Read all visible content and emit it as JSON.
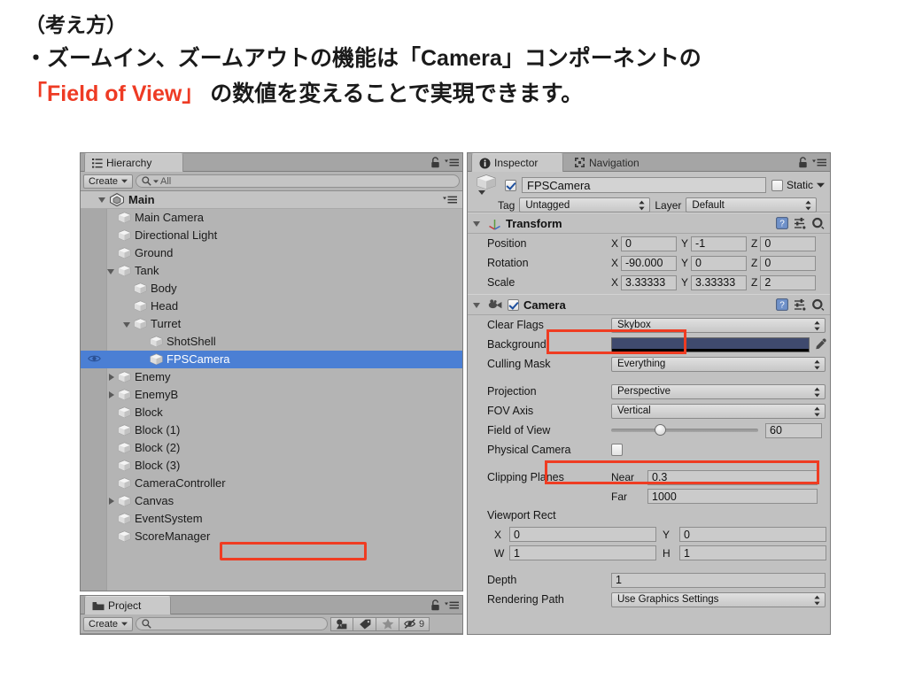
{
  "slide": {
    "line1": "（考え方）",
    "line2_a": "・ズームイン、ズームアウトの機能は「Camera」コンポーネントの",
    "line3_accent": "「Field of View」",
    "line3_rest": " の数値を変えることで実現できます。",
    "accent_color": "#ee3b24"
  },
  "hierarchy": {
    "tab_label": "Hierarchy",
    "tab_icon": "hierarchy-icon",
    "lock_icon": "lock-icon",
    "menu_icon": "hamburger-menu-icon",
    "create_label": "Create",
    "search_placeholder": "All",
    "search_value": "",
    "root": {
      "label": "Main",
      "icon": "unity-scene-icon",
      "expanded": true
    },
    "selected_item": "FPSCamera",
    "items": [
      {
        "label": "Main Camera",
        "indent": 2,
        "arrow": "none",
        "selected": false,
        "eye": false
      },
      {
        "label": "Directional Light",
        "indent": 2,
        "arrow": "none",
        "selected": false,
        "eye": false
      },
      {
        "label": "Ground",
        "indent": 2,
        "arrow": "none",
        "selected": false,
        "eye": false
      },
      {
        "label": "Tank",
        "indent": 2,
        "arrow": "open",
        "selected": false,
        "eye": false
      },
      {
        "label": "Body",
        "indent": 3,
        "arrow": "none",
        "selected": false,
        "eye": false
      },
      {
        "label": "Head",
        "indent": 3,
        "arrow": "none",
        "selected": false,
        "eye": false
      },
      {
        "label": "Turret",
        "indent": 3,
        "arrow": "open",
        "selected": false,
        "eye": false
      },
      {
        "label": "ShotShell",
        "indent": 4,
        "arrow": "none",
        "selected": false,
        "eye": false
      },
      {
        "label": "FPSCamera",
        "indent": 4,
        "arrow": "none",
        "selected": true,
        "eye": true
      },
      {
        "label": "Enemy",
        "indent": 2,
        "arrow": "closed",
        "selected": false,
        "eye": false
      },
      {
        "label": "EnemyB",
        "indent": 2,
        "arrow": "closed",
        "selected": false,
        "eye": false
      },
      {
        "label": "Block",
        "indent": 2,
        "arrow": "none",
        "selected": false,
        "eye": false
      },
      {
        "label": "Block (1)",
        "indent": 2,
        "arrow": "none",
        "selected": false,
        "eye": false
      },
      {
        "label": "Block (2)",
        "indent": 2,
        "arrow": "none",
        "selected": false,
        "eye": false
      },
      {
        "label": "Block (3)",
        "indent": 2,
        "arrow": "none",
        "selected": false,
        "eye": false
      },
      {
        "label": "CameraController",
        "indent": 2,
        "arrow": "none",
        "selected": false,
        "eye": false
      },
      {
        "label": "Canvas",
        "indent": 2,
        "arrow": "closed",
        "selected": false,
        "eye": false
      },
      {
        "label": "EventSystem",
        "indent": 2,
        "arrow": "none",
        "selected": false,
        "eye": false
      },
      {
        "label": "ScoreManager",
        "indent": 2,
        "arrow": "none",
        "selected": false,
        "eye": false
      }
    ]
  },
  "project": {
    "tab_label": "Project",
    "tab_icon": "folder-icon",
    "lock_icon": "lock-icon",
    "menu_icon": "hamburger-menu-icon",
    "create_label": "Create",
    "search_placeholder": "",
    "search_value": "",
    "filter_buttons": [
      {
        "icon": "shapes-filter-icon",
        "label": ""
      },
      {
        "icon": "label-tag-icon",
        "label": ""
      },
      {
        "icon": "star-favorite-icon",
        "label": ""
      },
      {
        "icon": "hidden-eye-icon",
        "label": "9"
      }
    ]
  },
  "inspector": {
    "tabs": [
      {
        "label": "Inspector",
        "icon": "info-icon",
        "active": true
      },
      {
        "label": "Navigation",
        "icon": "navigation-icon",
        "active": false
      }
    ],
    "lock_icon": "lock-icon",
    "menu_icon": "hamburger-menu-icon",
    "object": {
      "icon": "gameobject-cube-icon",
      "enabled": true,
      "name": "FPSCamera",
      "static_label": "Static",
      "static_checked": false,
      "tag_label": "Tag",
      "tag_value": "Untagged",
      "layer_label": "Layer",
      "layer_value": "Default"
    },
    "components": [
      {
        "name": "Transform",
        "icon": "transform-axis-icon",
        "expanded": true,
        "has_checkbox": false,
        "highlighted": false,
        "vec_rows": [
          {
            "label": "Position",
            "x": "0",
            "y": "-1",
            "z": "0"
          },
          {
            "label": "Rotation",
            "x": "-90.000",
            "y": "0",
            "z": "0"
          },
          {
            "label": "Scale",
            "x": "3.33333",
            "y": "3.33333",
            "z": "2"
          }
        ]
      },
      {
        "name": "Camera",
        "icon": "camera-icon",
        "expanded": true,
        "has_checkbox": true,
        "checked": true,
        "highlighted": true,
        "fields": [
          {
            "kind": "dropdown",
            "label": "Clear Flags",
            "value": "Skybox"
          },
          {
            "kind": "color",
            "label": "Background",
            "value": "#3f4a6e",
            "eyedropper": "eyedropper-icon"
          },
          {
            "kind": "dropdown",
            "label": "Culling Mask",
            "value": "Everything"
          },
          {
            "kind": "spacer"
          },
          {
            "kind": "dropdown",
            "label": "Projection",
            "value": "Perspective"
          },
          {
            "kind": "dropdown",
            "label": "FOV Axis",
            "value": "Vertical"
          },
          {
            "kind": "slider",
            "label": "Field of View",
            "value": "60",
            "min": 1,
            "max": 179,
            "highlighted": true
          },
          {
            "kind": "checkbox",
            "label": "Physical Camera",
            "checked": false
          },
          {
            "kind": "spacer"
          },
          {
            "kind": "pair",
            "label": "Clipping Planes",
            "sub1": "Near",
            "val1": "0.3",
            "sub2": "Far",
            "val2": "1000"
          },
          {
            "kind": "grouphdr",
            "label": "Viewport Rect"
          },
          {
            "kind": "quad",
            "a_label": "X",
            "a_val": "0",
            "b_label": "Y",
            "b_val": "0",
            "c_label": "W",
            "c_val": "1",
            "d_label": "H",
            "d_val": "1"
          },
          {
            "kind": "spacer"
          },
          {
            "kind": "text",
            "label": "Depth",
            "value": "1"
          },
          {
            "kind": "dropdown",
            "label": "Rendering Path",
            "value": "Use Graphics Settings"
          }
        ]
      }
    ],
    "help_icon": "help-book-icon",
    "preset_icon": "preset-sliders-icon",
    "gear_icon": "gear-icon"
  },
  "highlight_color": "#ef3c22"
}
